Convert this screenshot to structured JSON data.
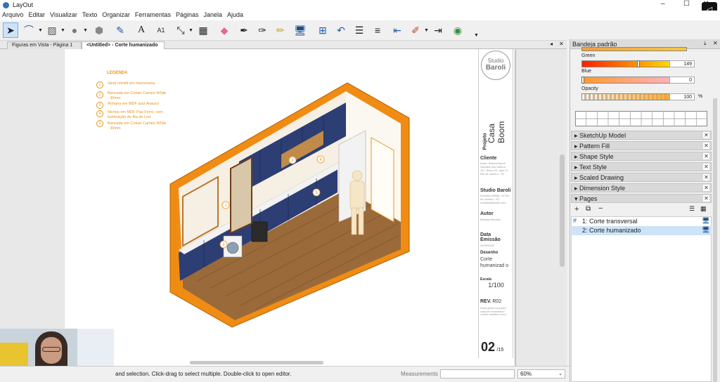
{
  "window": {
    "title": "LayOut"
  },
  "menu": [
    "Arquivo",
    "Editar",
    "Visualizar",
    "Texto",
    "Organizar",
    "Ferramentas",
    "Páginas",
    "Janela",
    "Ajuda"
  ],
  "tabs": {
    "tab1": "Figuras em Vista - Página 1",
    "tab2": "<Untitled> - Corte humanizado"
  },
  "legend": {
    "title": "LEGENDA",
    "items": [
      {
        "n": "1",
        "text": "Varal retrátil em marcenaria"
      },
      {
        "n": "2",
        "text": "Bancada em Corian Cameo White - 30mm"
      },
      {
        "n": "3",
        "text": "Armaria em MDF azul Anauco"
      },
      {
        "n": "4",
        "text": "Nichos em MDF Pau Ferro, com iluminação de fita de Led"
      },
      {
        "n": "5",
        "text": "Bancada em Corian Cameo White - 30mm"
      }
    ]
  },
  "titleblock": {
    "studio_line1": "Studio",
    "studio_line2": "Baroli",
    "projeto_label": "Projeto",
    "projeto_value": "Casa Boom",
    "cliente_label": "Cliente",
    "cliente_text": "Autor: Maiara Baroli Garrafal dos Santos, 157, Bloco 02, apto 11 Rio de Janeiro - RJ",
    "studio_label": "Studio Baroli",
    "studio_text": "Avenida Infinita, 44 Rio de Janeiro - RJ contato@studio.com",
    "autor_label": "Autor",
    "autor_text": "Mariana Bonicio",
    "data_label": "Data Emissão",
    "data_text": "00/00/0000",
    "desenho_label": "Desenho",
    "desenho_value": "Corte humanizad o",
    "escala_label": "Escala",
    "escala_value": "1/100",
    "rev_label": "REV.",
    "rev_value": "R02",
    "notes": "Notas gerais do projeto * cotas em centímetros * conferir medidas in loco",
    "page_num": "02",
    "page_total": "/15"
  },
  "status": {
    "hint": "and selection. Click-drag to select multiple. Double-click to open editor.",
    "measurements_label": "Measurements",
    "zoom": "60%"
  },
  "panel": {
    "title": "Bandeja padrão",
    "green_label": "Green",
    "green_value": "149",
    "blue_label": "Blue",
    "blue_value": "0",
    "opacity_label": "Opacity",
    "opacity_value": "100",
    "opacity_unit": "%",
    "sections": [
      "SketchUp Model",
      "Pattern Fill",
      "Shape Style",
      "Text Style",
      "Scaled Drawing",
      "Dimension Style"
    ],
    "pages_label": "Pages",
    "pages": [
      {
        "label": "1: Corte transversal",
        "selected": false
      },
      {
        "label": "2: Corte humanizado",
        "selected": true
      }
    ]
  },
  "colors": {
    "accent": "#e8931a",
    "cabinet_blue": "#2c3e74",
    "floor": "#9a6a3a",
    "selection": "#cde3f7"
  }
}
